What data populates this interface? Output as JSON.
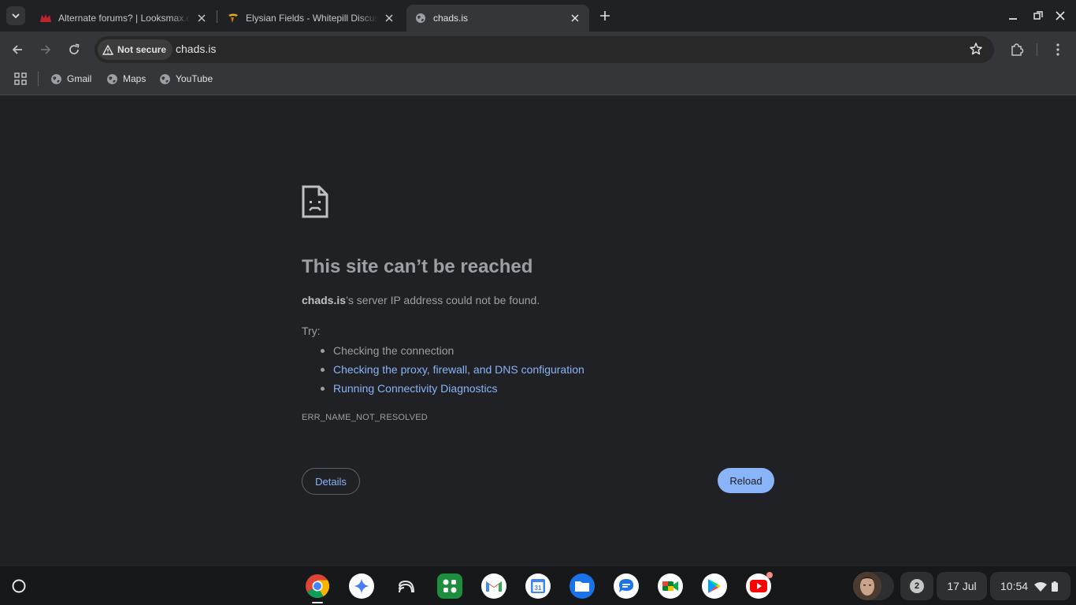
{
  "tabs": [
    {
      "title": "Alternate forums? | Looksmax.org",
      "active": false
    },
    {
      "title": "Elysian Fields - Whitepill Discussion",
      "active": false
    },
    {
      "title": "chads.is",
      "active": true
    }
  ],
  "omnibox": {
    "security_label": "Not secure",
    "url": "chads.is"
  },
  "bookmarks": [
    {
      "label": "Gmail"
    },
    {
      "label": "Maps"
    },
    {
      "label": "YouTube"
    }
  ],
  "error": {
    "title": "This site can’t be reached",
    "host": "chads.is",
    "description_suffix": "’s server IP address could not be found.",
    "try_label": "Try:",
    "suggestions": [
      "Checking the connection",
      "Checking the proxy, firewall, and DNS configuration",
      "Running Connectivity Diagnostics"
    ],
    "code": "ERR_NAME_NOT_RESOLVED",
    "details_label": "Details",
    "reload_label": "Reload"
  },
  "shelf": {
    "apps": [
      "chrome-icon",
      "gemini-icon",
      "cast-icon",
      "google-workspace-icon",
      "gmail-icon",
      "calendar-icon",
      "files-icon",
      "messages-icon",
      "meet-icon",
      "play-store-icon",
      "youtube-icon"
    ],
    "calendar_day": "31",
    "notification_count": "2",
    "date": "17 Jul",
    "time": "10:54"
  },
  "colors": {
    "accent": "#8ab4f8",
    "background": "#202124",
    "toolbar": "#35363a"
  }
}
